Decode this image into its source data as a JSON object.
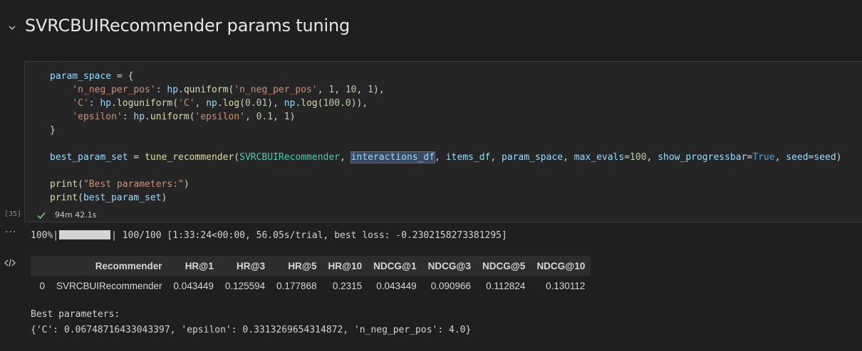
{
  "section": {
    "title": "SVRCBUIRecommender params tuning"
  },
  "cell": {
    "exec_count": "[35]",
    "duration": "94m 42.1s",
    "status": "success",
    "code_lines": [
      "param_space = {",
      "    'n_neg_per_pos': hp.quniform('n_neg_per_pos', 1, 10, 1),",
      "    'C': hp.loguniform('C', np.log(0.01), np.log(100.0)),",
      "    'epsilon': hp.uniform('epsilon', 0.1, 1)",
      "}",
      "",
      "best_param_set = tune_recommender(SVRCBUIRecommender, interactions_df, items_df, param_space, max_evals=100, show_progressbar=True, seed=seed)",
      "",
      "print(\"Best parameters:\")",
      "print(best_param_set)"
    ],
    "highlighted_token": "interactions_df"
  },
  "output": {
    "progress": {
      "percent_label": "100%|",
      "fraction": 1.0,
      "after": "| 100/100 [1:33:24<00:00, 56.05s/trial, best loss: -0.2302158273381295]"
    },
    "table": {
      "columns": [
        "",
        "Recommender",
        "HR@1",
        "HR@3",
        "HR@5",
        "HR@10",
        "NDCG@1",
        "NDCG@3",
        "NDCG@5",
        "NDCG@10"
      ],
      "rows": [
        [
          "0",
          "SVRCBUIRecommender",
          "0.043449",
          "0.125594",
          "0.177868",
          "0.2315",
          "0.043449",
          "0.090966",
          "0.112824",
          "0.130112"
        ]
      ]
    },
    "print_lines": [
      "Best parameters:",
      "{'C': 0.06748716433043397, 'epsilon': 0.3313269654314872, 'n_neg_per_pos': 4.0}"
    ]
  },
  "colors": {
    "background": "#1f1f1f",
    "cell_background": "#252526",
    "success_check": "#89d185",
    "string": "#ce9178",
    "function": "#dcdcaa",
    "variable": "#9cdcfe",
    "number": "#b5cea8",
    "class": "#4ec9b0",
    "keyword_bool": "#569cd6"
  },
  "icons": [
    "chevron-down-icon",
    "check-icon",
    "ellipsis-icon",
    "code-icon"
  ]
}
